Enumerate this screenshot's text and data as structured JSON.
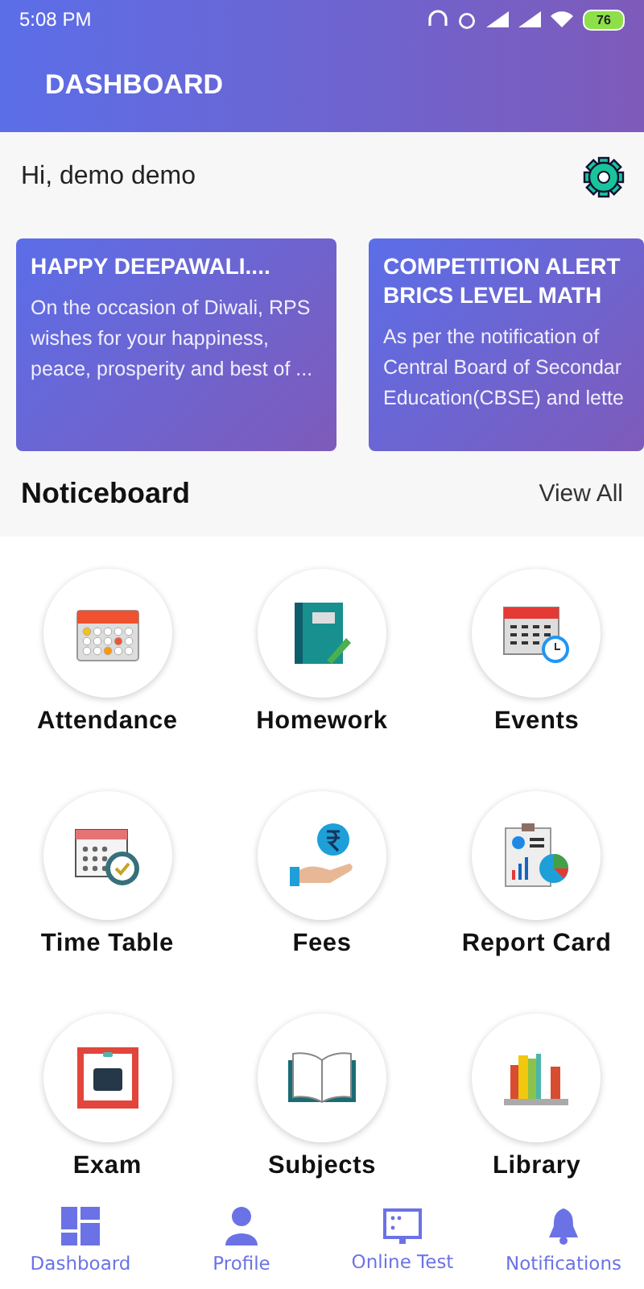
{
  "status_bar": {
    "time": "5:08 PM",
    "battery": "76"
  },
  "header": {
    "title": "DASHBOARD"
  },
  "greeting": "Hi, demo demo",
  "notices": [
    {
      "title_lines": [
        "HAPPY DEEPAWALI...."
      ],
      "body_lines": [
        "On the occasion of Diwali, RPS",
        "wishes for your happiness,",
        "peace, prosperity and best of ..."
      ]
    },
    {
      "title_lines": [
        "COMPETITION ALERT",
        "BRICS LEVEL MATH"
      ],
      "body_lines": [
        "As per the notification of",
        "Central Board of Secondar",
        "Education(CBSE) and lette"
      ]
    }
  ],
  "noticeboard": {
    "title": "Noticeboard",
    "link": "View All"
  },
  "modules": [
    {
      "label": "Attendance"
    },
    {
      "label": "Homework"
    },
    {
      "label": "Events"
    },
    {
      "label": "Time Table"
    },
    {
      "label": "Fees"
    },
    {
      "label": "Report Card"
    },
    {
      "label": "Exam"
    },
    {
      "label": "Subjects"
    },
    {
      "label": "Library"
    }
  ],
  "bottom_nav": [
    {
      "label": "Dashboard"
    },
    {
      "label": "Profile"
    },
    {
      "label": "Online Test"
    },
    {
      "label": "Notifications"
    }
  ]
}
